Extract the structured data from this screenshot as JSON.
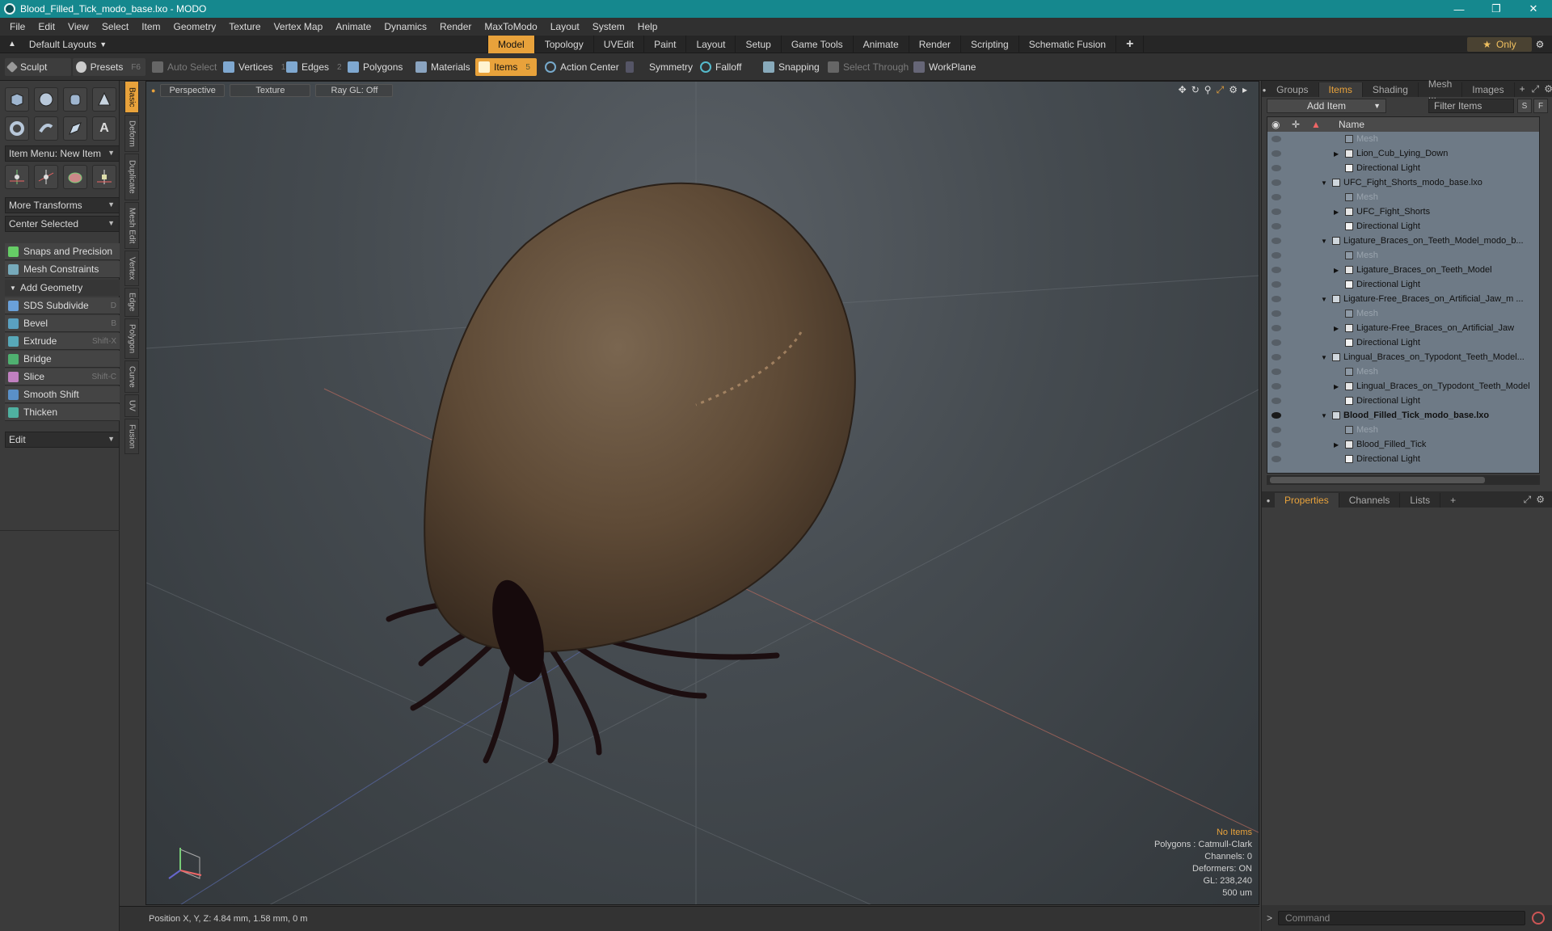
{
  "window": {
    "title": "Blood_Filled_Tick_modo_base.lxo - MODO"
  },
  "menu": [
    "File",
    "Edit",
    "View",
    "Select",
    "Item",
    "Geometry",
    "Texture",
    "Vertex Map",
    "Animate",
    "Dynamics",
    "Render",
    "MaxToModo",
    "Layout",
    "System",
    "Help"
  ],
  "layout": {
    "default_layouts": "Default Layouts",
    "tabs": [
      "Model",
      "Topology",
      "UVEdit",
      "Paint",
      "Layout",
      "Setup",
      "Game Tools",
      "Animate",
      "Render",
      "Scripting",
      "Schematic Fusion"
    ],
    "active_tab": "Model",
    "add_tab": "+",
    "only": "Only"
  },
  "toolbar": {
    "sculpt": "Sculpt",
    "presets": "Presets",
    "presets_key": "F6",
    "auto_select": "Auto Select",
    "vertices": "Vertices",
    "vertices_key": "1",
    "edges": "Edges",
    "edges_key": "2",
    "polygons": "Polygons",
    "materials": "Materials",
    "items": "Items",
    "items_key": "5",
    "action_center": "Action Center",
    "symmetry": "Symmetry",
    "falloff": "Falloff",
    "snapping": "Snapping",
    "select_through": "Select Through",
    "workplane": "WorkPlane"
  },
  "left": {
    "item_menu": "Item Menu: New Item",
    "more_transforms": "More Transforms",
    "center_selected": "Center Selected",
    "snaps": "Snaps and Precision",
    "mesh_constraints": "Mesh Constraints",
    "add_geometry": "Add Geometry",
    "tools": [
      {
        "label": "SDS Subdivide",
        "key": "D",
        "color": "#6aa0d8"
      },
      {
        "label": "Bevel",
        "key": "B",
        "color": "#5aa0c0"
      },
      {
        "label": "Extrude",
        "key": "Shift-X",
        "color": "#58a8b8"
      },
      {
        "label": "Bridge",
        "key": "",
        "color": "#4fb070"
      },
      {
        "label": "Slice",
        "key": "Shift-C",
        "color": "#c080c0"
      },
      {
        "label": "Smooth Shift",
        "key": "",
        "color": "#5a90c8"
      },
      {
        "label": "Thicken",
        "key": "",
        "color": "#4fb0a0"
      }
    ],
    "edit": "Edit",
    "vtabs": [
      "Basic",
      "Deform",
      "Duplicate",
      "Mesh Edit",
      "Vertex",
      "Edge",
      "Polygon",
      "Curve",
      "UV",
      "Fusion"
    ]
  },
  "viewport": {
    "perspective": "Perspective",
    "texture": "Texture",
    "raygl": "Ray GL: Off",
    "stats": {
      "no_items": "No Items",
      "polygons": "Polygons : Catmull-Clark",
      "channels": "Channels: 0",
      "deformers": "Deformers: ON",
      "gl": "GL: 238,240",
      "scale": "500 um"
    }
  },
  "status": {
    "position": "Position X, Y, Z:  4.84 mm, 1.58 mm, 0 m"
  },
  "right": {
    "tabs": [
      "Groups",
      "Items",
      "Shading",
      "Mesh ...",
      "Images"
    ],
    "active_tab": "Items",
    "add_item": "Add Item",
    "filter": "Filter Items",
    "s": "S",
    "f": "F",
    "name_col": "Name",
    "tree": [
      {
        "label": "Mesh",
        "indent": 2,
        "kind": "mesh"
      },
      {
        "label": "Lion_Cub_Lying_Down",
        "indent": 2,
        "kind": "item"
      },
      {
        "label": "Directional Light",
        "indent": 2,
        "kind": "light"
      },
      {
        "label": "UFC_Fight_Shorts_modo_base.lxo",
        "indent": 1,
        "kind": "scene"
      },
      {
        "label": "Mesh",
        "indent": 2,
        "kind": "mesh"
      },
      {
        "label": "UFC_Fight_Shorts",
        "indent": 2,
        "kind": "item"
      },
      {
        "label": "Directional Light",
        "indent": 2,
        "kind": "light"
      },
      {
        "label": "Ligature_Braces_on_Teeth_Model_modo_b...",
        "indent": 1,
        "kind": "scene"
      },
      {
        "label": "Mesh",
        "indent": 2,
        "kind": "mesh"
      },
      {
        "label": "Ligature_Braces_on_Teeth_Model",
        "indent": 2,
        "kind": "item"
      },
      {
        "label": "Directional Light",
        "indent": 2,
        "kind": "light"
      },
      {
        "label": "Ligature-Free_Braces_on_Artificial_Jaw_m ...",
        "indent": 1,
        "kind": "scene"
      },
      {
        "label": "Mesh",
        "indent": 2,
        "kind": "mesh"
      },
      {
        "label": "Ligature-Free_Braces_on_Artificial_Jaw",
        "indent": 2,
        "kind": "item"
      },
      {
        "label": "Directional Light",
        "indent": 2,
        "kind": "light"
      },
      {
        "label": "Lingual_Braces_on_Typodont_Teeth_Model...",
        "indent": 1,
        "kind": "scene"
      },
      {
        "label": "Mesh",
        "indent": 2,
        "kind": "mesh"
      },
      {
        "label": "Lingual_Braces_on_Typodont_Teeth_Model",
        "indent": 2,
        "kind": "item"
      },
      {
        "label": "Directional Light",
        "indent": 2,
        "kind": "light"
      },
      {
        "label": "Blood_Filled_Tick_modo_base.lxo",
        "indent": 1,
        "kind": "scene",
        "bold": true
      },
      {
        "label": "Mesh",
        "indent": 2,
        "kind": "mesh"
      },
      {
        "label": "Blood_Filled_Tick",
        "indent": 2,
        "kind": "item"
      },
      {
        "label": "Directional Light",
        "indent": 2,
        "kind": "light"
      }
    ],
    "ptabs": [
      "Properties",
      "Channels",
      "Lists"
    ],
    "active_ptab": "Properties",
    "add_ptab": "+",
    "command": "Command"
  }
}
